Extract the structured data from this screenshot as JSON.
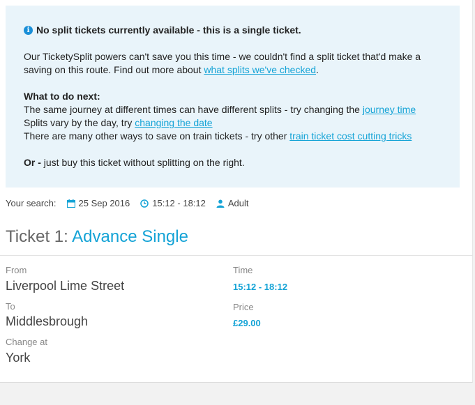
{
  "notice": {
    "title": "No split tickets currently available - this is a single ticket.",
    "para1_text": "Our TicketySplit powers can't save you this time - we couldn't find a split ticket that'd make a saving on this route. Find out more about ",
    "para1_link": "what splits we've checked",
    "para1_end": ".",
    "next_heading": "What to do next:",
    "line1_text": "The same journey at different times can have different splits - try changing the ",
    "line1_link": "journey time",
    "line2_text": "Splits vary by the day, try ",
    "line2_link": "changing the date",
    "line3_text": "There are many other ways to save on train tickets - try other ",
    "line3_link": "train ticket cost cutting tricks",
    "or_label": "Or -",
    "or_text": " just buy this ticket without splitting on the right."
  },
  "search": {
    "label": "Your search:",
    "date": "25 Sep 2016",
    "time": "15:12 - 18:12",
    "passenger": "Adult"
  },
  "ticket": {
    "prefix": "Ticket 1: ",
    "type": "Advance Single",
    "from_label": "From",
    "from_value": "Liverpool Lime Street",
    "to_label": "To",
    "to_value": "Middlesbrough",
    "change_label": "Change at",
    "change_value": "York",
    "time_label": "Time",
    "time_value": "15:12 - 18:12",
    "price_label": "Price",
    "price_value": "£29.00"
  },
  "colors": {
    "accent": "#14a3d6",
    "notice_bg": "#e9f4fa",
    "info_icon": "#1a8fd8"
  },
  "icons": {
    "info": "info-icon",
    "calendar": "calendar-icon",
    "clock": "clock-icon",
    "person": "person-icon"
  }
}
